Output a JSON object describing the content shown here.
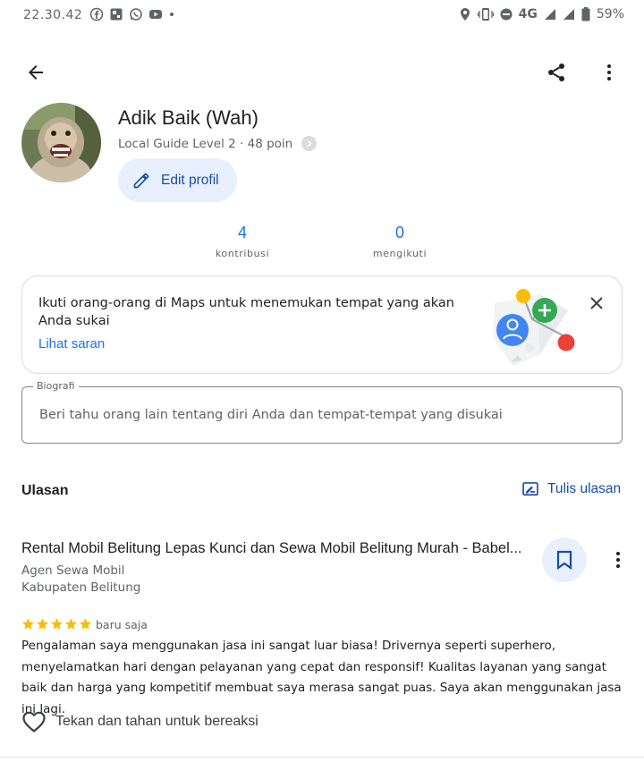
{
  "status_bar": {
    "time": "22.30.42",
    "network": "4G",
    "battery": "59%",
    "left_icons": [
      "facebook-icon",
      "photo-icon",
      "whatsapp-icon",
      "youtube-icon"
    ],
    "right_icons": [
      "location-icon",
      "vibrate-icon",
      "do-not-disturb-icon",
      "signal-icon",
      "battery-icon"
    ]
  },
  "profile": {
    "name": "Adik Baik (Wah)",
    "level_text": "Local Guide Level 2 · 48 poin",
    "edit_label": "Edit profil"
  },
  "stats": [
    {
      "value": "4",
      "label": "kontribusi"
    },
    {
      "value": "0",
      "label": "mengikuti"
    }
  ],
  "suggestion": {
    "text": "Ikuti orang-orang di Maps untuk menemukan tempat yang akan Anda sukai",
    "link": "Lihat saran"
  },
  "bio": {
    "label": "Biografi",
    "placeholder": "Beri tahu orang lain tentang diri Anda dan tempat-tempat yang disukai"
  },
  "reviews_section": {
    "title": "Ulasan",
    "write_label": "Tulis ulasan"
  },
  "review": {
    "place": "Rental Mobil Belitung Lepas Kunci dan Sewa Mobil Belitung Murah - Babel...",
    "category": "Agen Sewa Mobil",
    "location": "Kabupaten Belitung",
    "rating": 5,
    "time": "baru saja",
    "body": "Pengalaman saya menggunakan jasa ini sangat luar biasa! Drivernya seperti superhero, menyelamatkan hari dengan pelayanan yang cepat dan responsif! Kualitas layanan yang sangat baik dan harga yang kompetitif membuat saya merasa sangat puas. Saya akan menggunakan jasa ini lagi.",
    "react_label": "Tekan dan tahan untuk bereaksi"
  },
  "colors": {
    "accent": "#1a73e8",
    "accent_dark": "#174ea6",
    "chip_bg": "#e8f0fe",
    "star": "#fbbc04"
  }
}
